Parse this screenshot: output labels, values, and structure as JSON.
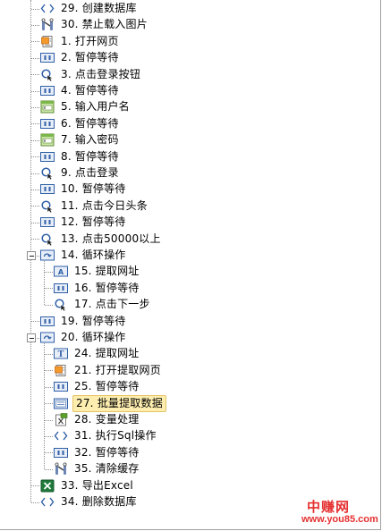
{
  "tree": {
    "items": [
      {
        "label": "29. 创建数据库",
        "icon": "code-brackets-icon",
        "level": 0
      },
      {
        "label": "30. 禁止载入图片",
        "icon": "tool-icon",
        "level": 0
      },
      {
        "label": "1. 打开网页",
        "icon": "open-page-icon",
        "level": 0
      },
      {
        "label": "2. 暂停等待",
        "icon": "pause-icon",
        "level": 0
      },
      {
        "label": "3. 点击登录按钮",
        "icon": "click-icon",
        "level": 0
      },
      {
        "label": "4. 暂停等待",
        "icon": "pause-icon",
        "level": 0
      },
      {
        "label": "5. 输入用户名",
        "icon": "input-icon",
        "level": 0
      },
      {
        "label": "6. 暂停等待",
        "icon": "pause-icon",
        "level": 0
      },
      {
        "label": "7. 输入密码",
        "icon": "input-icon",
        "level": 0
      },
      {
        "label": "8. 暂停等待",
        "icon": "pause-icon",
        "level": 0
      },
      {
        "label": "9. 点击登录",
        "icon": "click-icon",
        "level": 0
      },
      {
        "label": "10. 暂停等待",
        "icon": "pause-icon",
        "level": 0
      },
      {
        "label": "11. 点击今日头条",
        "icon": "click-icon",
        "level": 0
      },
      {
        "label": "12. 暂停等待",
        "icon": "pause-icon",
        "level": 0
      },
      {
        "label": "13. 点击50000以上",
        "icon": "click-icon",
        "level": 0
      },
      {
        "label": "14. 循环操作",
        "icon": "loop-icon",
        "level": 0,
        "expanded": true
      },
      {
        "label": "15. 提取网址",
        "icon": "extract-url-icon",
        "level": 1
      },
      {
        "label": "16. 暂停等待",
        "icon": "pause-icon",
        "level": 1
      },
      {
        "label": "17. 点击下一步",
        "icon": "click-icon",
        "level": 1
      },
      {
        "label": "19. 暂停等待",
        "icon": "pause-icon",
        "level": 0
      },
      {
        "label": "20. 循环操作",
        "icon": "loop-icon",
        "level": 0,
        "expanded": true
      },
      {
        "label": "24. 提取网址",
        "icon": "extract-text-icon",
        "level": 1
      },
      {
        "label": "21. 打开提取网页",
        "icon": "open-page-icon",
        "level": 1
      },
      {
        "label": "25. 暂停等待",
        "icon": "pause-icon",
        "level": 1
      },
      {
        "label": "27. 批量提取数据",
        "icon": "batch-extract-icon",
        "level": 1,
        "selected": true
      },
      {
        "label": "28. 变量处理",
        "icon": "variable-icon",
        "level": 1
      },
      {
        "label": "31. 执行Sql操作",
        "icon": "code-brackets-icon",
        "level": 1
      },
      {
        "label": "32. 暂停等待",
        "icon": "pause-icon",
        "level": 1
      },
      {
        "label": "35. 清除缓存",
        "icon": "tool-icon",
        "level": 1
      },
      {
        "label": "33. 导出Excel",
        "icon": "excel-icon",
        "level": 0
      },
      {
        "label": "34. 删除数据库",
        "icon": "code-brackets-icon",
        "level": 0
      }
    ]
  },
  "watermark": {
    "name": "中赚网",
    "url": "www.you85.com"
  },
  "colors": {
    "selection_bg": "#fdeeb0",
    "selection_border": "#e5c365",
    "watermark": "#e53030",
    "icon_blue": "#2f5fa7"
  }
}
